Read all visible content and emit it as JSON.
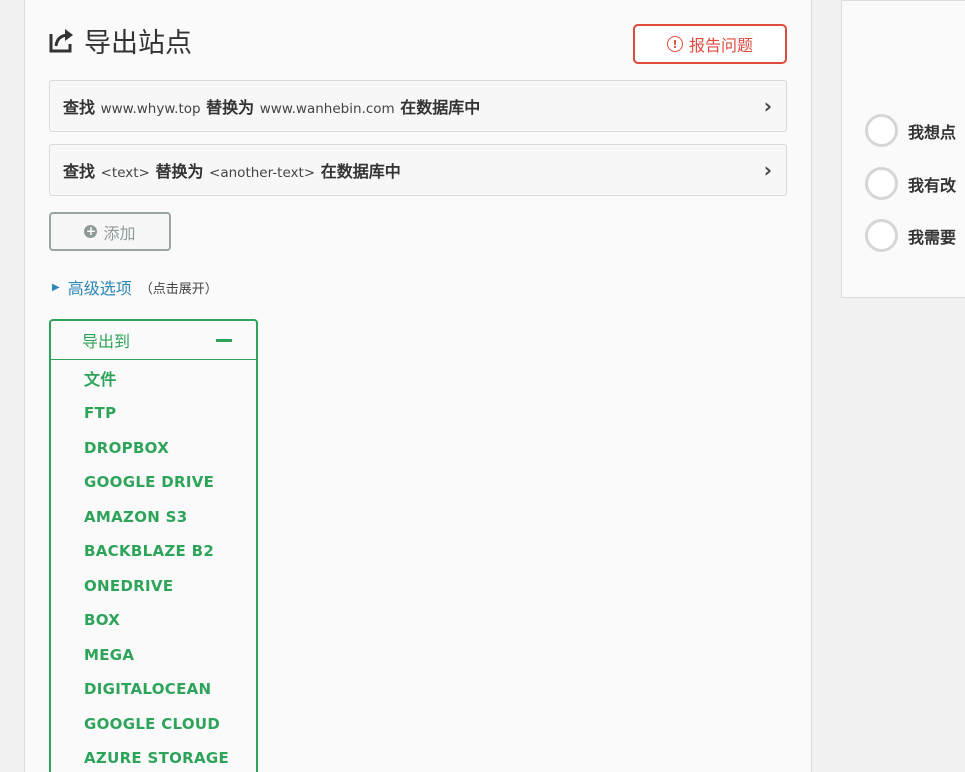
{
  "page": {
    "title": "导出站点",
    "title_icon": "share-export-icon",
    "report_label": "报告问题",
    "report_icon": "warning-circle-icon"
  },
  "search_replace": [
    {
      "prefix": "查找",
      "find": "www.whyw.top",
      "mid": "替换为",
      "replace": "www.wanhebin.com",
      "suffix": "在数据库中"
    },
    {
      "prefix": "查找",
      "find": "<text>",
      "mid": "替换为",
      "replace": "<another-text>",
      "suffix": "在数据库中"
    }
  ],
  "add_label": "添加",
  "advanced": {
    "label": "高级选项",
    "hint": "（点击展开）"
  },
  "export": {
    "heading": "导出到",
    "destinations": [
      "文件",
      "FTP",
      "DROPBOX",
      "GOOGLE DRIVE",
      "AMAZON S3",
      "BACKBLAZE B2",
      "ONEDRIVE",
      "BOX",
      "MEGA",
      "DIGITALOCEAN",
      "GOOGLE CLOUD",
      "AZURE STORAGE"
    ]
  },
  "side_options": [
    "我想点",
    "我有改",
    "我需要"
  ],
  "colors": {
    "accent_green": "#2ea35a",
    "report_red": "#dd4a3e",
    "link_blue": "#2d87b7"
  }
}
